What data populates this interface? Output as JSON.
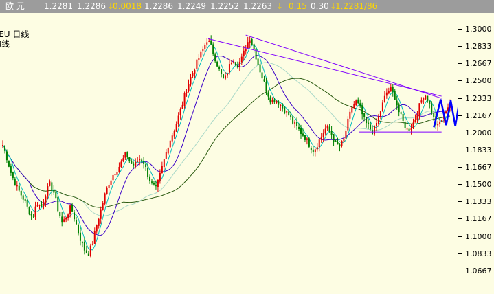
{
  "quote_bar": {
    "name": "欧  元",
    "last": "1.2281",
    "bid": "1.2286",
    "change": "0.0018",
    "open": "1.2286",
    "low": "1.2249",
    "prev": "1.2252",
    "high": "1.2263",
    "change_pct": "0.15",
    "vol": "0.30",
    "tick": "1.2281/86"
  },
  "legend": {
    "symbol": "XEU  日线",
    "sub": "均线"
  },
  "colors": {
    "up_candle": "#e00000",
    "down_candle": "#008000",
    "ma_short": "#00bcbc",
    "ma_mid": "#3a00c8",
    "ma_long": "#2a5a10",
    "ma_faint": "#a8d8c8",
    "trendline": "#8000ff",
    "zigzag": "#0000ff"
  },
  "chart_data": {
    "type": "candlestick",
    "instrument": "XEU",
    "period": "日线",
    "ylim": [
      1.05,
      1.31
    ],
    "yticks": [
      "1.3000",
      "1.2833",
      "1.2667",
      "1.2500",
      "1.2333",
      "1.2167",
      "1.2000",
      "1.1833",
      "1.1667",
      "1.1500",
      "1.1333",
      "1.1167",
      "1.1000",
      "1.0833",
      "1.0667"
    ],
    "close_path": [
      1.188,
      1.175,
      1.16,
      1.15,
      1.142,
      1.135,
      1.125,
      1.118,
      1.132,
      1.128,
      1.14,
      1.15,
      1.142,
      1.125,
      1.112,
      1.12,
      1.128,
      1.115,
      1.1,
      1.088,
      1.082,
      1.092,
      1.11,
      1.125,
      1.14,
      1.152,
      1.16,
      1.165,
      1.172,
      1.18,
      1.17,
      1.168,
      1.175,
      1.172,
      1.16,
      1.15,
      1.145,
      1.16,
      1.175,
      1.19,
      1.2,
      1.212,
      1.225,
      1.24,
      1.252,
      1.262,
      1.272,
      1.28,
      1.29,
      1.282,
      1.27,
      1.258,
      1.25,
      1.262,
      1.272,
      1.265,
      1.27,
      1.282,
      1.292,
      1.28,
      1.265,
      1.252,
      1.24,
      1.23,
      1.232,
      1.228,
      1.222,
      1.218,
      1.21,
      1.205,
      1.2,
      1.195,
      1.188,
      1.182,
      1.19,
      1.198,
      1.205,
      1.2,
      1.19,
      1.186,
      1.192,
      1.21,
      1.225,
      1.23,
      1.222,
      1.21,
      1.205,
      1.2,
      1.212,
      1.225,
      1.238,
      1.242,
      1.235,
      1.22,
      1.21,
      1.202,
      1.206,
      1.215,
      1.228,
      1.238,
      1.23,
      1.215,
      1.205,
      1.212,
      1.222,
      1.228
    ],
    "trendlines": [
      {
        "from": [
          0.455,
          1.2905
        ],
        "to": [
          0.965,
          1.235
        ]
      },
      {
        "from": [
          0.537,
          1.294
        ],
        "to": [
          0.965,
          1.233
        ]
      },
      {
        "from": [
          0.785,
          1.2005
        ],
        "to": [
          0.965,
          1.2005
        ]
      }
    ],
    "zigzag": [
      [
        0.948,
        1.205
      ],
      [
        0.963,
        1.232
      ],
      [
        0.975,
        1.207
      ],
      [
        0.985,
        1.231
      ],
      [
        0.995,
        1.206
      ],
      [
        1.005,
        1.233
      ],
      [
        1.015,
        1.217
      ]
    ]
  }
}
